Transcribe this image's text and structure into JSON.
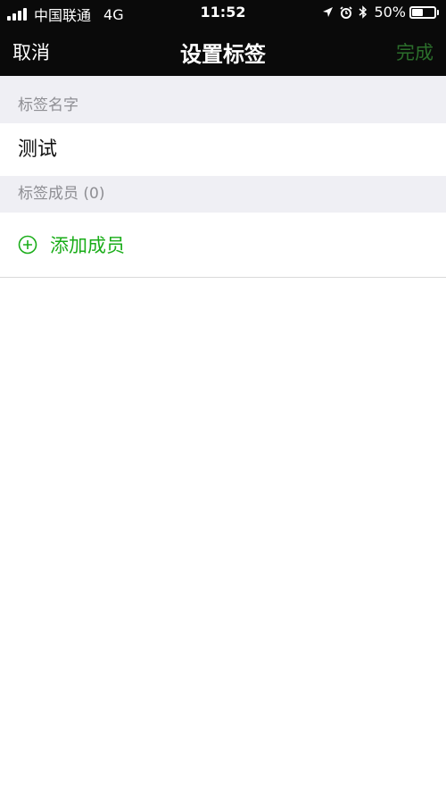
{
  "status_bar": {
    "carrier": "中国联通",
    "network": "4G",
    "time": "11:52",
    "battery_percent": "50%",
    "battery_level": 0.5
  },
  "nav": {
    "cancel_label": "取消",
    "title": "设置标签",
    "done_label": "完成"
  },
  "sections": {
    "name_header": "标签名字",
    "name_value": "测试",
    "members_header": "标签成员 (0)",
    "add_member_label": "添加成员"
  },
  "colors": {
    "accent_green": "#1aad19",
    "done_disabled": "#2b6e2b",
    "nav_bg": "#0a0a0a",
    "section_bg": "#efeff4",
    "section_text": "#8e8e93"
  },
  "icons": {
    "location": "location-arrow-icon",
    "alarm": "alarm-icon",
    "bluetooth": "bluetooth-icon",
    "add": "plus-circle-icon"
  }
}
